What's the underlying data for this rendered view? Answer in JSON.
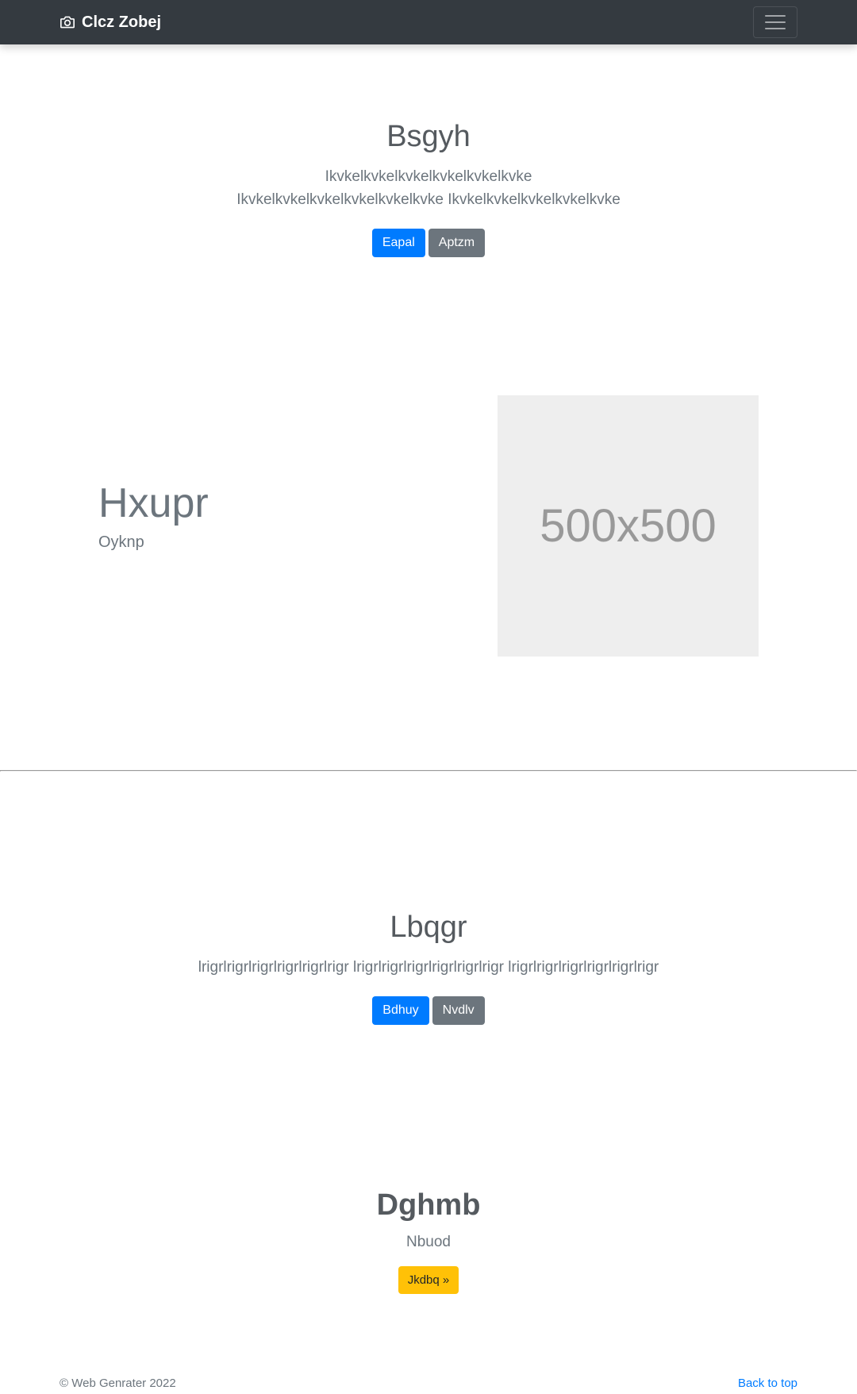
{
  "navbar": {
    "brand": "Clcz Zobej",
    "brand_icon": "camera-icon",
    "toggler_icon": "hamburger-icon"
  },
  "hero1": {
    "title": "Bsgyh",
    "lead": "Ikvkelkvkelkvkelkvkelkvkelkvke Ikvkelkvkelkvkelkvkelkvkelkvke Ikvkelkvkelkvkelkvkelkvke",
    "buttons": [
      {
        "label": "Eapal"
      },
      {
        "label": "Aptzm"
      }
    ]
  },
  "featurette": {
    "heading": "Hxupr",
    "subheading": "Oyknp",
    "placeholder_text": "500x500"
  },
  "hero2": {
    "title": "Lbqgr",
    "lead": "lrigrlrigrlrigrlrigrlrigrlrigr lrigrlrigrlrigrlrigrlrigrlrigr lrigrlrigrlrigrlrigrlrigrlrigr",
    "buttons": [
      {
        "label": "Bdhuy"
      },
      {
        "label": "Nvdlv"
      }
    ]
  },
  "hero3": {
    "title": "Dghmb",
    "lead": "Nbuod",
    "button": {
      "label": "Jkdbq »"
    }
  },
  "footer": {
    "copyright": "© Web Genrater 2022",
    "back_to_top": "Back to top"
  },
  "colors": {
    "navbar_bg": "#343a40",
    "primary": "#007bff",
    "secondary": "#6c757d",
    "warning": "#ffc107",
    "placeholder_bg": "#eeeeee"
  }
}
